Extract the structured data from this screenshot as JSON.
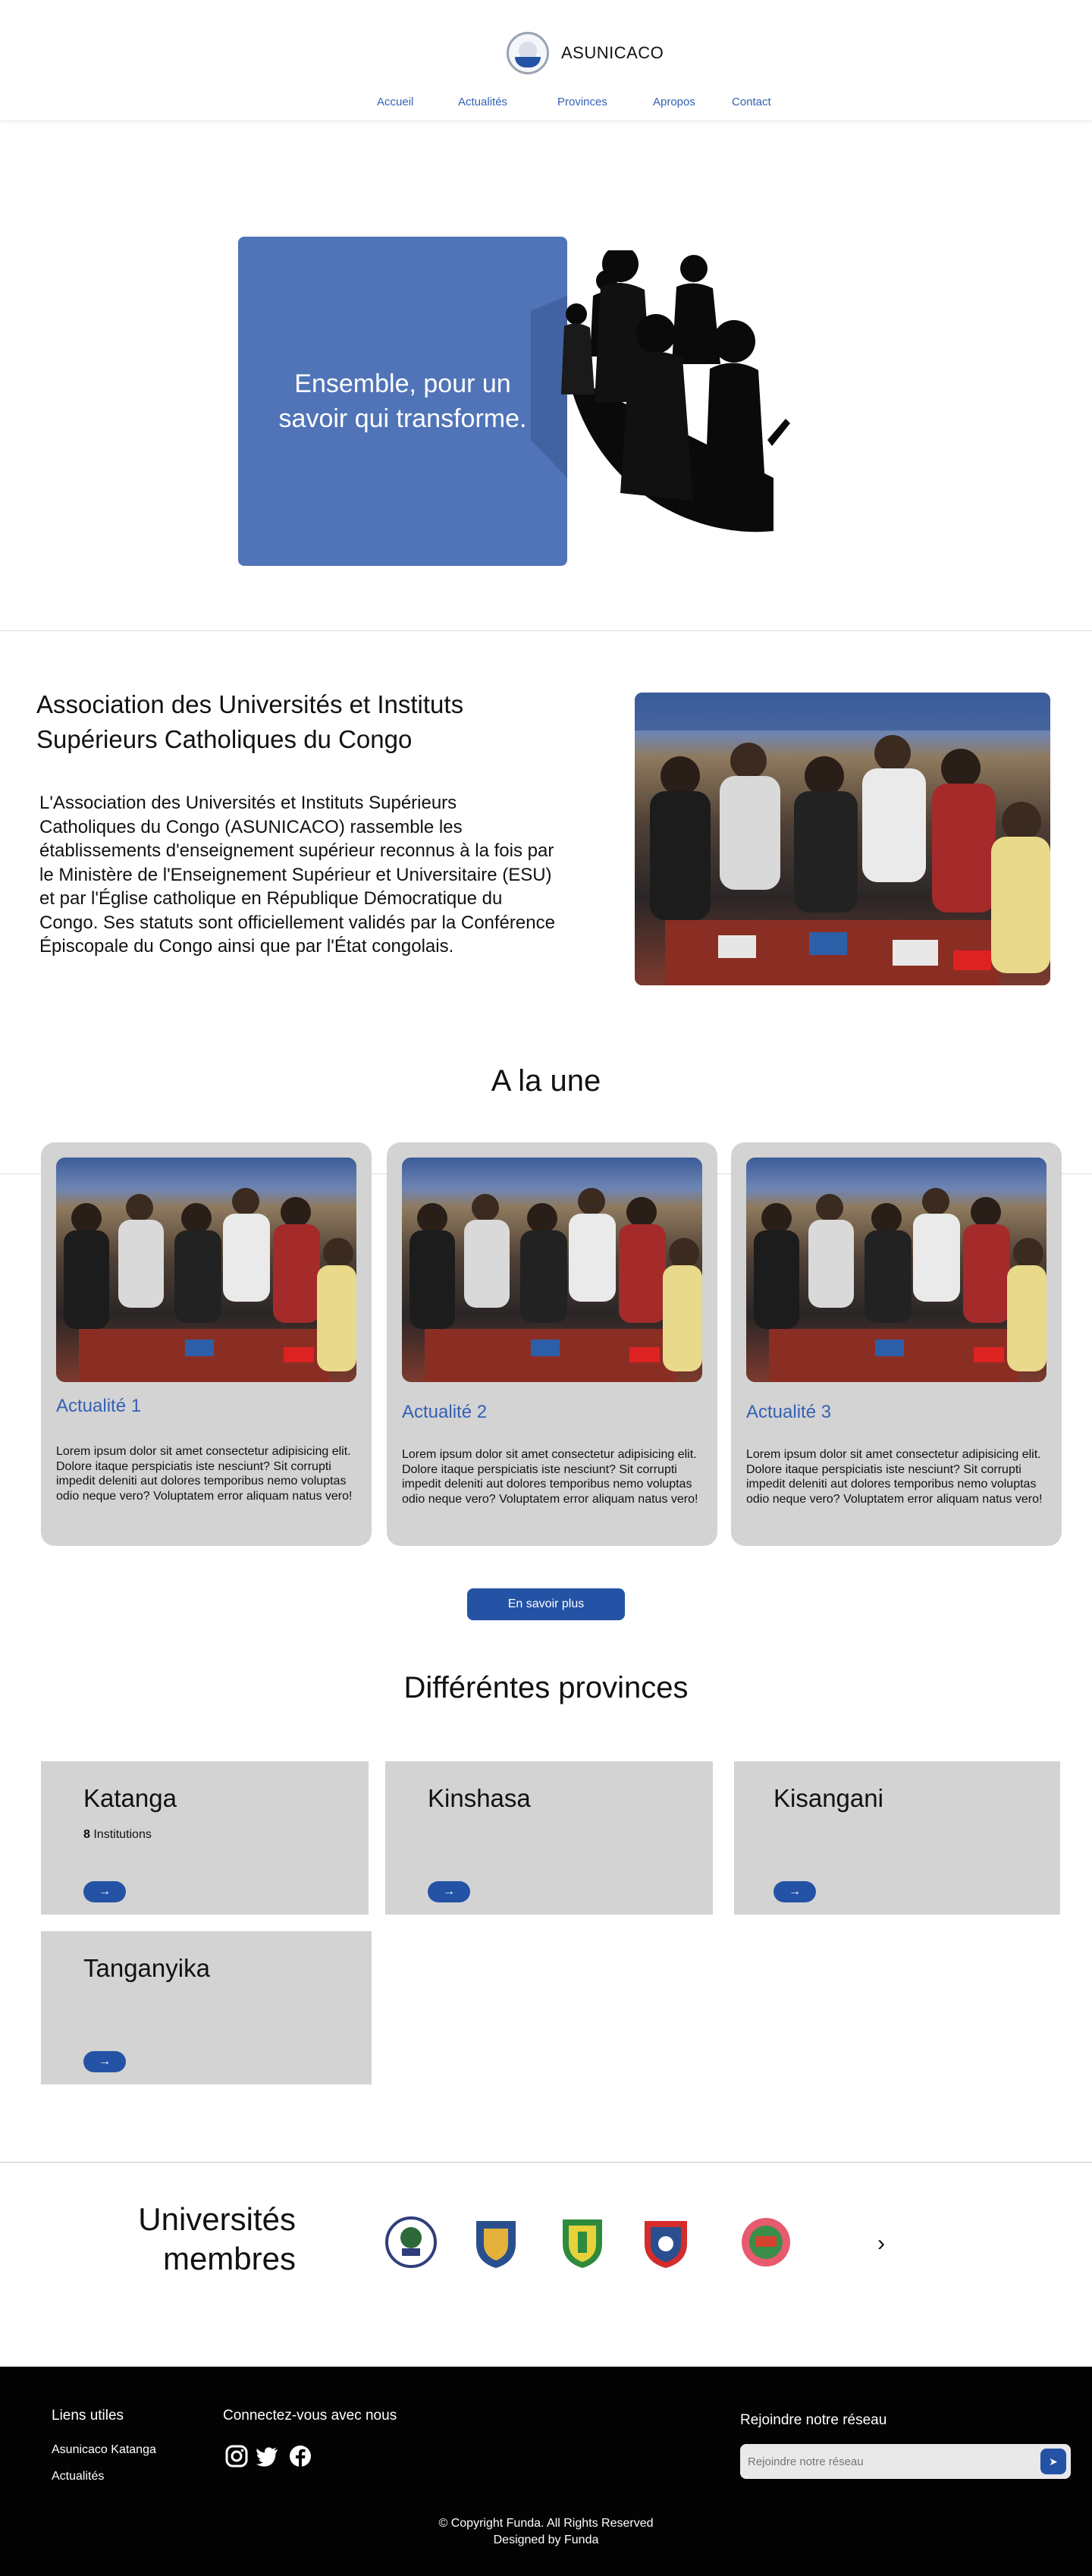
{
  "header": {
    "brand_name": "ASUNICACO",
    "nav": [
      {
        "label": "Accueil"
      },
      {
        "label": "Actualités"
      },
      {
        "label": "Provinces"
      },
      {
        "label": "Apropos"
      },
      {
        "label": "Contact"
      }
    ]
  },
  "hero": {
    "tagline": "Ensemble, pour un savoir qui transforme."
  },
  "about": {
    "title": "Association des Universités et Instituts Supérieurs Catholiques du Congo",
    "body": "L'Association des Universités et Instituts Supérieurs Catholiques du Congo (ASUNICACO) rassemble les établissements d'enseignement supérieur reconnus à la fois par le Ministère de l'Enseignement Supérieur et Universitaire (ESU) et par l'Église catholique en République Démocratique du Congo. Ses statuts sont officiellement validés par la Conférence Épiscopale du Congo ainsi que par l'État congolais."
  },
  "news": {
    "title": "A la une",
    "items": [
      {
        "title": "Actualité 1",
        "text": "Lorem ipsum dolor sit amet consectetur adipisicing elit. Dolore itaque perspiciatis iste nesciunt? Sit corrupti impedit deleniti aut dolores temporibus nemo voluptas odio neque vero? Voluptatem error aliquam natus vero!"
      },
      {
        "title": "Actualité 2",
        "text": "Lorem ipsum dolor sit amet consectetur adipisicing elit. Dolore itaque perspiciatis iste nesciunt? Sit corrupti impedit deleniti aut dolores temporibus nemo voluptas odio neque vero? Voluptatem error aliquam natus vero!"
      },
      {
        "title": "Actualité 3",
        "text": "Lorem ipsum dolor sit amet consectetur adipisicing elit. Dolore itaque perspiciatis iste nesciunt? Sit corrupti impedit deleniti aut dolores temporibus nemo voluptas odio neque vero? Voluptatem error aliquam natus vero!"
      }
    ],
    "more_label": "En savoir plus"
  },
  "provinces": {
    "title": "Différéntes provinces",
    "items": [
      {
        "name": "Katanga",
        "count": "8",
        "count_label": "Institutions"
      },
      {
        "name": "Kinshasa"
      },
      {
        "name": "Kisangani"
      },
      {
        "name": "Tanganyika"
      }
    ],
    "arrow": "→"
  },
  "universities": {
    "title_line1": "Universités",
    "title_line2": "membres",
    "next": "›",
    "logos": [
      "university-crest-1",
      "university-crest-2",
      "university-crest-3",
      "university-crest-4",
      "university-crest-5"
    ]
  },
  "footer": {
    "links_title": "Liens utiles",
    "links": [
      "Asunicaco Katanga",
      "Actualités"
    ],
    "social_title": "Connectez-vous avec nous",
    "social": [
      "instagram-icon",
      "twitter-icon",
      "facebook-icon"
    ],
    "join_title": "Rejoindre notre réseau",
    "join_placeholder": "Rejoindre notre réseau",
    "join_button": "➤",
    "copyright_line1": "© Copyright Funda. All Rights Reserved",
    "copyright_line2": "Designed by Funda"
  },
  "colors": {
    "accent": "#2453a6",
    "hero_box": "#5074b7",
    "card": "#d3d3d3",
    "footer": "#030303",
    "link": "#3461b5"
  }
}
